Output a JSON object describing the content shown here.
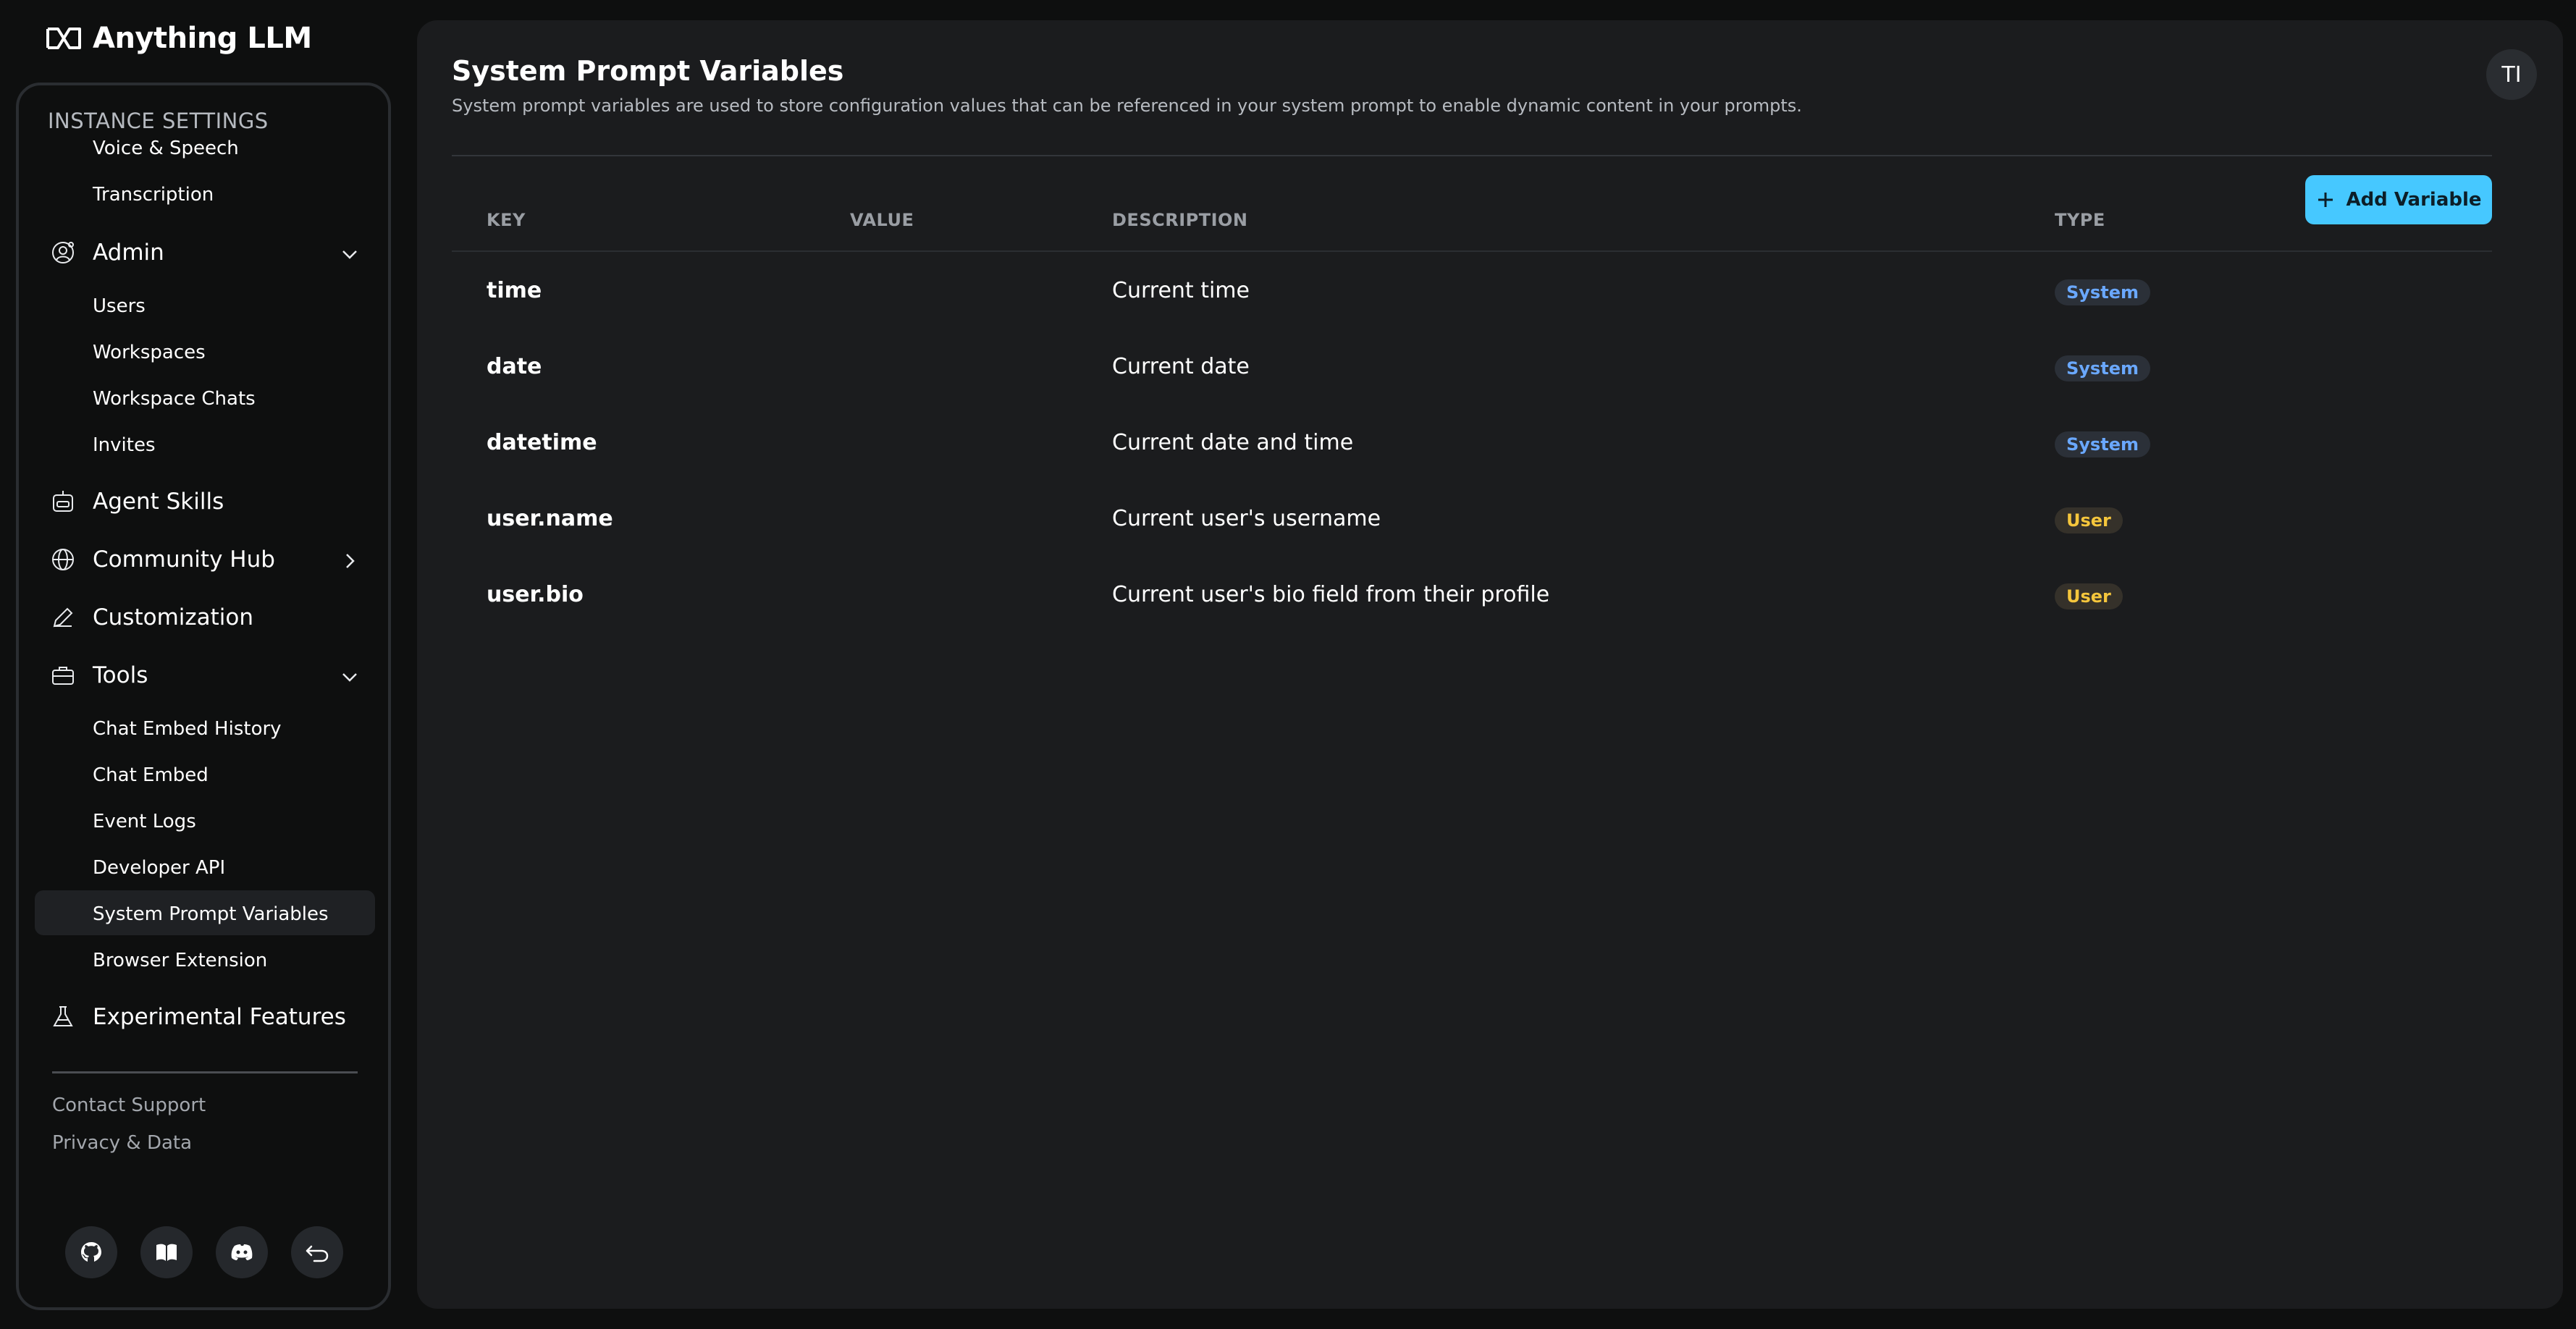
{
  "app": {
    "name": "Anything LLM"
  },
  "sidebar": {
    "heading": "INSTANCE SETTINGS",
    "ai_providers_subitems": [
      "Voice & Speech",
      "Transcription"
    ],
    "admin": {
      "label": "Admin",
      "items": [
        "Users",
        "Workspaces",
        "Workspace Chats",
        "Invites"
      ]
    },
    "agent_skills": "Agent Skills",
    "community_hub": "Community Hub",
    "customization": "Customization",
    "tools": {
      "label": "Tools",
      "items": [
        "Chat Embed History",
        "Chat Embed",
        "Event Logs",
        "Developer API",
        "System Prompt Variables",
        "Browser Extension"
      ]
    },
    "experimental": "Experimental Features",
    "footer_links": [
      "Contact Support",
      "Privacy & Data"
    ]
  },
  "header": {
    "title": "System Prompt Variables",
    "description": "System prompt variables are used to store configuration values that can be referenced in your system prompt to enable dynamic content in your prompts.",
    "avatar_initials": "TI"
  },
  "toolbar": {
    "add_label": "Add Variable"
  },
  "table": {
    "columns": [
      "KEY",
      "VALUE",
      "DESCRIPTION",
      "TYPE"
    ],
    "rows": [
      {
        "key": "time",
        "value": "",
        "description": "Current time",
        "type": "System"
      },
      {
        "key": "date",
        "value": "",
        "description": "Current date",
        "type": "System"
      },
      {
        "key": "datetime",
        "value": "",
        "description": "Current date and time",
        "type": "System"
      },
      {
        "key": "user.name",
        "value": "",
        "description": "Current user's username",
        "type": "User"
      },
      {
        "key": "user.bio",
        "value": "",
        "description": "Current user's bio field from their profile",
        "type": "User"
      }
    ]
  },
  "colors": {
    "accent": "#46c8ff",
    "system_badge_text": "#6aa8ff",
    "system_badge_bg": "#2b3038",
    "user_badge_text": "#f5c63c",
    "user_badge_bg": "#35312a"
  },
  "icons": {
    "bottom": [
      "github-icon",
      "book-icon",
      "discord-icon",
      "back-icon"
    ]
  }
}
